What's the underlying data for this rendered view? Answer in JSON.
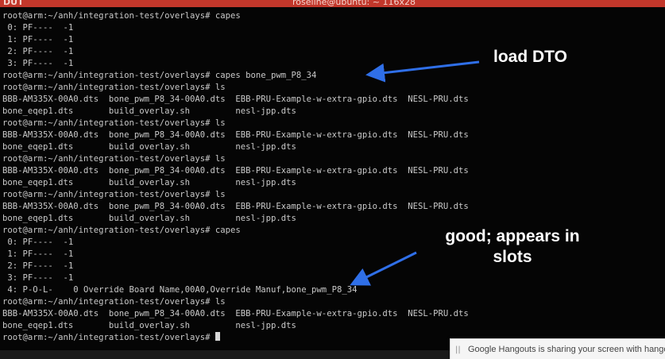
{
  "window": {
    "title_left": "DUT",
    "title_center": "roseline@ubuntu: ~ 116x28"
  },
  "terminal": {
    "lines": [
      "root@arm:~/anh/integration-test/overlays# capes",
      " 0: PF----  -1",
      " 1: PF----  -1",
      " 2: PF----  -1",
      " 3: PF----  -1",
      "root@arm:~/anh/integration-test/overlays# capes bone_pwm_P8_34",
      "root@arm:~/anh/integration-test/overlays# ls",
      "BBB-AM335X-00A0.dts  bone_pwm_P8_34-00A0.dts  EBB-PRU-Example-w-extra-gpio.dts  NESL-PRU.dts",
      "bone_eqep1.dts       build_overlay.sh         nesl-jpp.dts",
      "root@arm:~/anh/integration-test/overlays# ls",
      "BBB-AM335X-00A0.dts  bone_pwm_P8_34-00A0.dts  EBB-PRU-Example-w-extra-gpio.dts  NESL-PRU.dts",
      "bone_eqep1.dts       build_overlay.sh         nesl-jpp.dts",
      "root@arm:~/anh/integration-test/overlays# ls",
      "BBB-AM335X-00A0.dts  bone_pwm_P8_34-00A0.dts  EBB-PRU-Example-w-extra-gpio.dts  NESL-PRU.dts",
      "bone_eqep1.dts       build_overlay.sh         nesl-jpp.dts",
      "root@arm:~/anh/integration-test/overlays# ls",
      "BBB-AM335X-00A0.dts  bone_pwm_P8_34-00A0.dts  EBB-PRU-Example-w-extra-gpio.dts  NESL-PRU.dts",
      "bone_eqep1.dts       build_overlay.sh         nesl-jpp.dts",
      "root@arm:~/anh/integration-test/overlays# capes",
      " 0: PF----  -1",
      " 1: PF----  -1",
      " 2: PF----  -1",
      " 3: PF----  -1",
      " 4: P-O-L-    0 Override Board Name,00A0,Override Manuf,bone_pwm_P8_34",
      "root@arm:~/anh/integration-test/overlays# ls",
      "BBB-AM335X-00A0.dts  bone_pwm_P8_34-00A0.dts  EBB-PRU-Example-w-extra-gpio.dts  NESL-PRU.dts",
      "bone_eqep1.dts       build_overlay.sh         nesl-jpp.dts",
      "root@arm:~/anh/integration-test/overlays# "
    ]
  },
  "annotations": {
    "load_dto": "load DTO",
    "good_line1": "good; appears in",
    "good_line2": "slots"
  },
  "notification": {
    "text": "Google Hangouts is sharing your screen with hangouts"
  },
  "colors": {
    "titlebar": "#c2372b",
    "terminal_bg": "#050505",
    "terminal_fg": "#c9c9c9",
    "arrow": "#2f6fe8"
  }
}
